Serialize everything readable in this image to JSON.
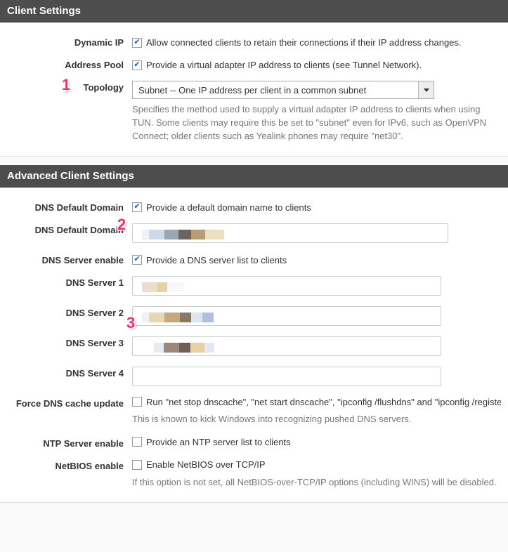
{
  "client_settings": {
    "header": "Client Settings",
    "dynamic_ip": {
      "label": "Dynamic IP",
      "checkbox_label": "Allow connected clients to retain their connections if their IP address changes.",
      "checked": true
    },
    "address_pool": {
      "label": "Address Pool",
      "checkbox_label": "Provide a virtual adapter IP address to clients (see Tunnel Network).",
      "checked": true
    },
    "topology": {
      "label": "Topology",
      "selected": "Subnet -- One IP address per client in a common subnet",
      "help": "Specifies the method used to supply a virtual adapter IP address to clients when using TUN. Some clients may require this be set to \"subnet\" even for IPv6, such as OpenVPN Connect; older clients such as Yealink phones may require \"net30\"."
    }
  },
  "advanced": {
    "header": "Advanced Client Settings",
    "dns_default_domain_enable": {
      "label": "DNS Default Domain",
      "checkbox_label": "Provide a default domain name to clients",
      "checked": true
    },
    "dns_default_domain": {
      "label": "DNS Default Domain",
      "value": ""
    },
    "dns_server_enable": {
      "label": "DNS Server enable",
      "checkbox_label": "Provide a DNS server list to clients",
      "checked": true
    },
    "dns_server_1": {
      "label": "DNS Server 1",
      "value": ""
    },
    "dns_server_2": {
      "label": "DNS Server 2",
      "value": ""
    },
    "dns_server_3": {
      "label": "DNS Server 3",
      "value": ""
    },
    "dns_server_4": {
      "label": "DNS Server 4",
      "value": ""
    },
    "force_dns_cache": {
      "label": "Force DNS cache update",
      "checkbox_label": "Run \"net stop dnscache\", \"net start dnscache\", \"ipconfig /flushdns\" and \"ipconfig /registerdns\"",
      "checked": false,
      "help": "This is known to kick Windows into recognizing pushed DNS servers."
    },
    "ntp_enable": {
      "label": "NTP Server enable",
      "checkbox_label": "Provide an NTP server list to clients",
      "checked": false
    },
    "netbios_enable": {
      "label": "NetBIOS enable",
      "checkbox_label": "Enable NetBIOS over TCP/IP",
      "checked": false,
      "help": "If this option is not set, all NetBIOS-over-TCP/IP options (including WINS) will be disabled."
    }
  },
  "annotations": {
    "1": "1",
    "2": "2",
    "3": "3"
  }
}
